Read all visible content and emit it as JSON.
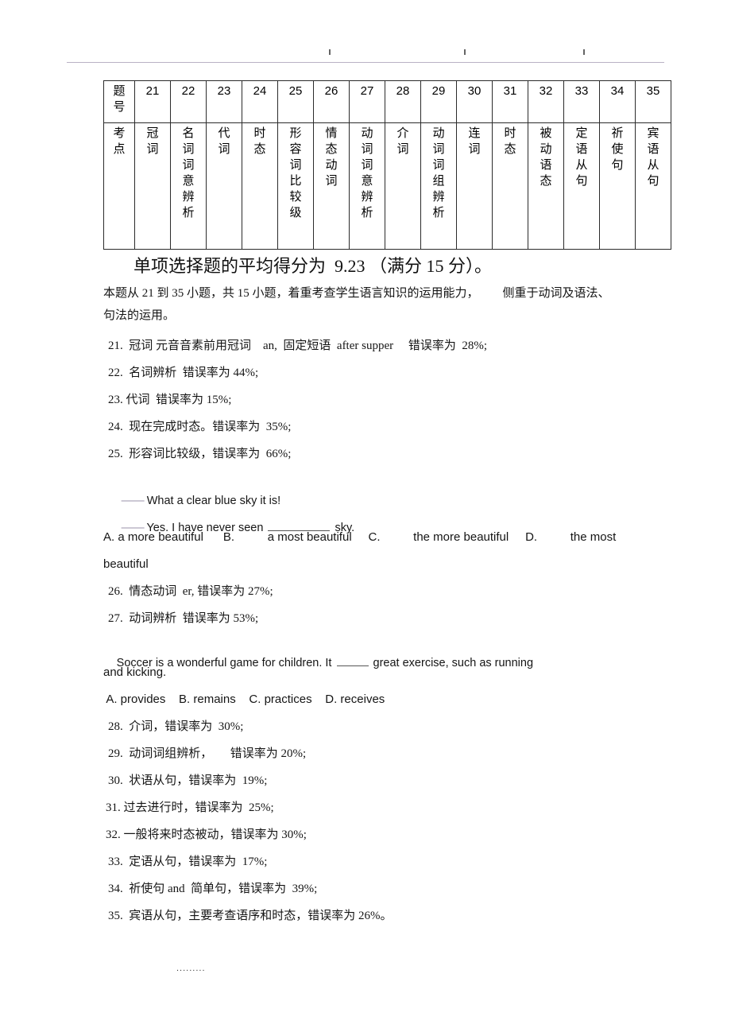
{
  "header": {
    "rule_color": "#b9b2c4",
    "mark_positions": [
      330,
      500,
      650
    ]
  },
  "table": {
    "row_labels": [
      "题\n号",
      "考\n点"
    ],
    "question_numbers": [
      "21",
      "22",
      "23",
      "24",
      "25",
      "26",
      "27",
      "28",
      "29",
      "30",
      "31",
      "32",
      "33",
      "34",
      "35"
    ],
    "points": [
      "冠\n词",
      "名\n词\n词\n意\n辨\n析",
      "代\n词",
      "时\n态",
      "形\n容\n词\n比\n较\n级",
      "情\n态\n动\n词",
      "动\n词\n词\n意\n辨\n析",
      "介\n词",
      "动\n词\n词\n组\n辨\n析",
      "连\n词",
      "时\n态",
      "被\n动\n语\n态",
      "定\n语\n从\n句",
      "祈\n使\n句",
      "宾\n语\n从\n句"
    ]
  },
  "headline": "单项选择题的平均得分为  9.23 （满分 15 分）。",
  "intro": {
    "line1": "本题从 21 到 35 小题，共 15 小题，着重考查学生语言知识的运用能力，        侧重于动词及语法、",
    "line2": "句法的运用。"
  },
  "items": {
    "q21": "21.  冠词 元音音素前用冠词    an,  固定短语  after supper     错误率为  28%;",
    "q22": "22.  名词辨析  错误率为 44%;",
    "q23": "23. 代词  错误率为 15%;",
    "q24": "24.  现在完成时态。错误率为  35%;",
    "q25": "25.  形容词比较级，错误率为  66%;",
    "q25_dialog_1_dash": "——",
    "q25_dialog_1_text": " What a clear blue sky it is!",
    "q25_dialog_2_dash": "——",
    "q25_dialog_2_text_a": " Yes. I have never seen ",
    "q25_dialog_2_text_b": " sky.",
    "q25_options_line1": "A. a more beautiful      B.          a most beautiful     C.          the more beautiful     D.          the most",
    "q25_options_line2": "beautiful",
    "q26": "26.  情态动词  er, 错误率为 27%;",
    "q27": "27.  动词辨析  错误率为 53%;",
    "q27_stem_a": "Soccer is a wonderful game for children. It ",
    "q27_stem_b": " great exercise, such as running",
    "q27_stem_line2": "and kicking.",
    "q27_options": " A. provides    B. remains    C. practices    D. receives",
    "q28": "28.  介词，错误率为  30%;",
    "q29": "29.  动词词组辨析，      错误率为 20%;",
    "q30": "30.  状语从句，错误率为  19%;",
    "q31": "31. 过去进行时，错误率为  25%;",
    "q32": "32. 一般将来时态被动，错误率为 30%;",
    "q33": "33.  定语从句，错误率为  17%;",
    "q34": "34.  祈使句 and  简单句，错误率为  39%;",
    "q35": "35.  宾语从句，主要考查语序和时态，错误率为 26%。"
  },
  "footer": {
    "dots": "........."
  }
}
